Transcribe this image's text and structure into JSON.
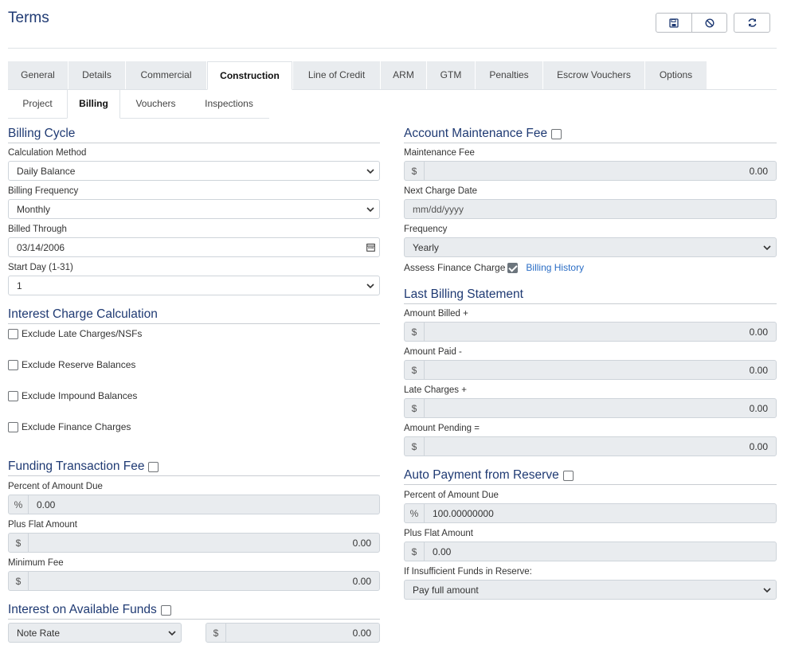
{
  "page": {
    "title": "Terms"
  },
  "toolbar": {
    "save_icon": "save-icon",
    "cancel_icon": "cancel-icon",
    "refresh_icon": "refresh-icon"
  },
  "main_tabs": [
    "General",
    "Details",
    "Commercial",
    "Construction",
    "Line of Credit",
    "ARM",
    "GTM",
    "Penalties",
    "Escrow Vouchers",
    "Options"
  ],
  "sub_tabs": [
    "Project",
    "Billing",
    "Vouchers",
    "Inspections"
  ],
  "billing_cycle": {
    "title": "Billing Cycle",
    "calc_method_label": "Calculation Method",
    "calc_method_value": "Daily Balance",
    "billing_freq_label": "Billing Frequency",
    "billing_freq_value": "Monthly",
    "billed_through_label": "Billed Through",
    "billed_through_value": "03/14/2006",
    "start_day_label": "Start Day (1-31)",
    "start_day_value": "1"
  },
  "interest_calc": {
    "title": "Interest Charge Calculation",
    "exclude_late": "Exclude Late Charges/NSFs",
    "exclude_reserve": "Exclude Reserve Balances",
    "exclude_impound": "Exclude Impound Balances",
    "exclude_finance": "Exclude Finance Charges"
  },
  "funding_fee": {
    "title": "Funding Transaction Fee",
    "percent_label": "Percent of Amount Due",
    "percent_prefix": "%",
    "percent_value": "0.00",
    "flat_label": "Plus Flat Amount",
    "flat_prefix": "$",
    "flat_value": "0.00",
    "min_label": "Minimum Fee",
    "min_prefix": "$",
    "min_value": "0.00"
  },
  "interest_funds": {
    "title": "Interest on Available Funds",
    "rate_select": "Note Rate",
    "amount_prefix": "$",
    "amount_value": "0.00"
  },
  "maintenance_fee": {
    "title": "Account Maintenance Fee",
    "fee_label": "Maintenance Fee",
    "fee_prefix": "$",
    "fee_value": "0.00",
    "next_date_label": "Next Charge Date",
    "next_date_placeholder": "mm/dd/yyyy",
    "frequency_label": "Frequency",
    "frequency_value": "Yearly",
    "assess_label": "Assess Finance Charge",
    "billing_history_link": "Billing History"
  },
  "last_statement": {
    "title": "Last Billing Statement",
    "billed_label": "Amount Billed +",
    "billed_value": "0.00",
    "paid_label": "Amount Paid -",
    "paid_value": "0.00",
    "late_label": "Late Charges +",
    "late_value": "0.00",
    "pending_label": "Amount Pending =",
    "pending_value": "0.00",
    "prefix": "$"
  },
  "auto_payment": {
    "title": "Auto Payment from Reserve",
    "percent_label": "Percent of Amount Due",
    "percent_prefix": "%",
    "percent_value": "100.00000000",
    "flat_label": "Plus Flat Amount",
    "flat_prefix": "$",
    "flat_value": "0.00",
    "insufficient_label": "If Insufficient Funds in Reserve:",
    "insufficient_value": "Pay full amount"
  }
}
